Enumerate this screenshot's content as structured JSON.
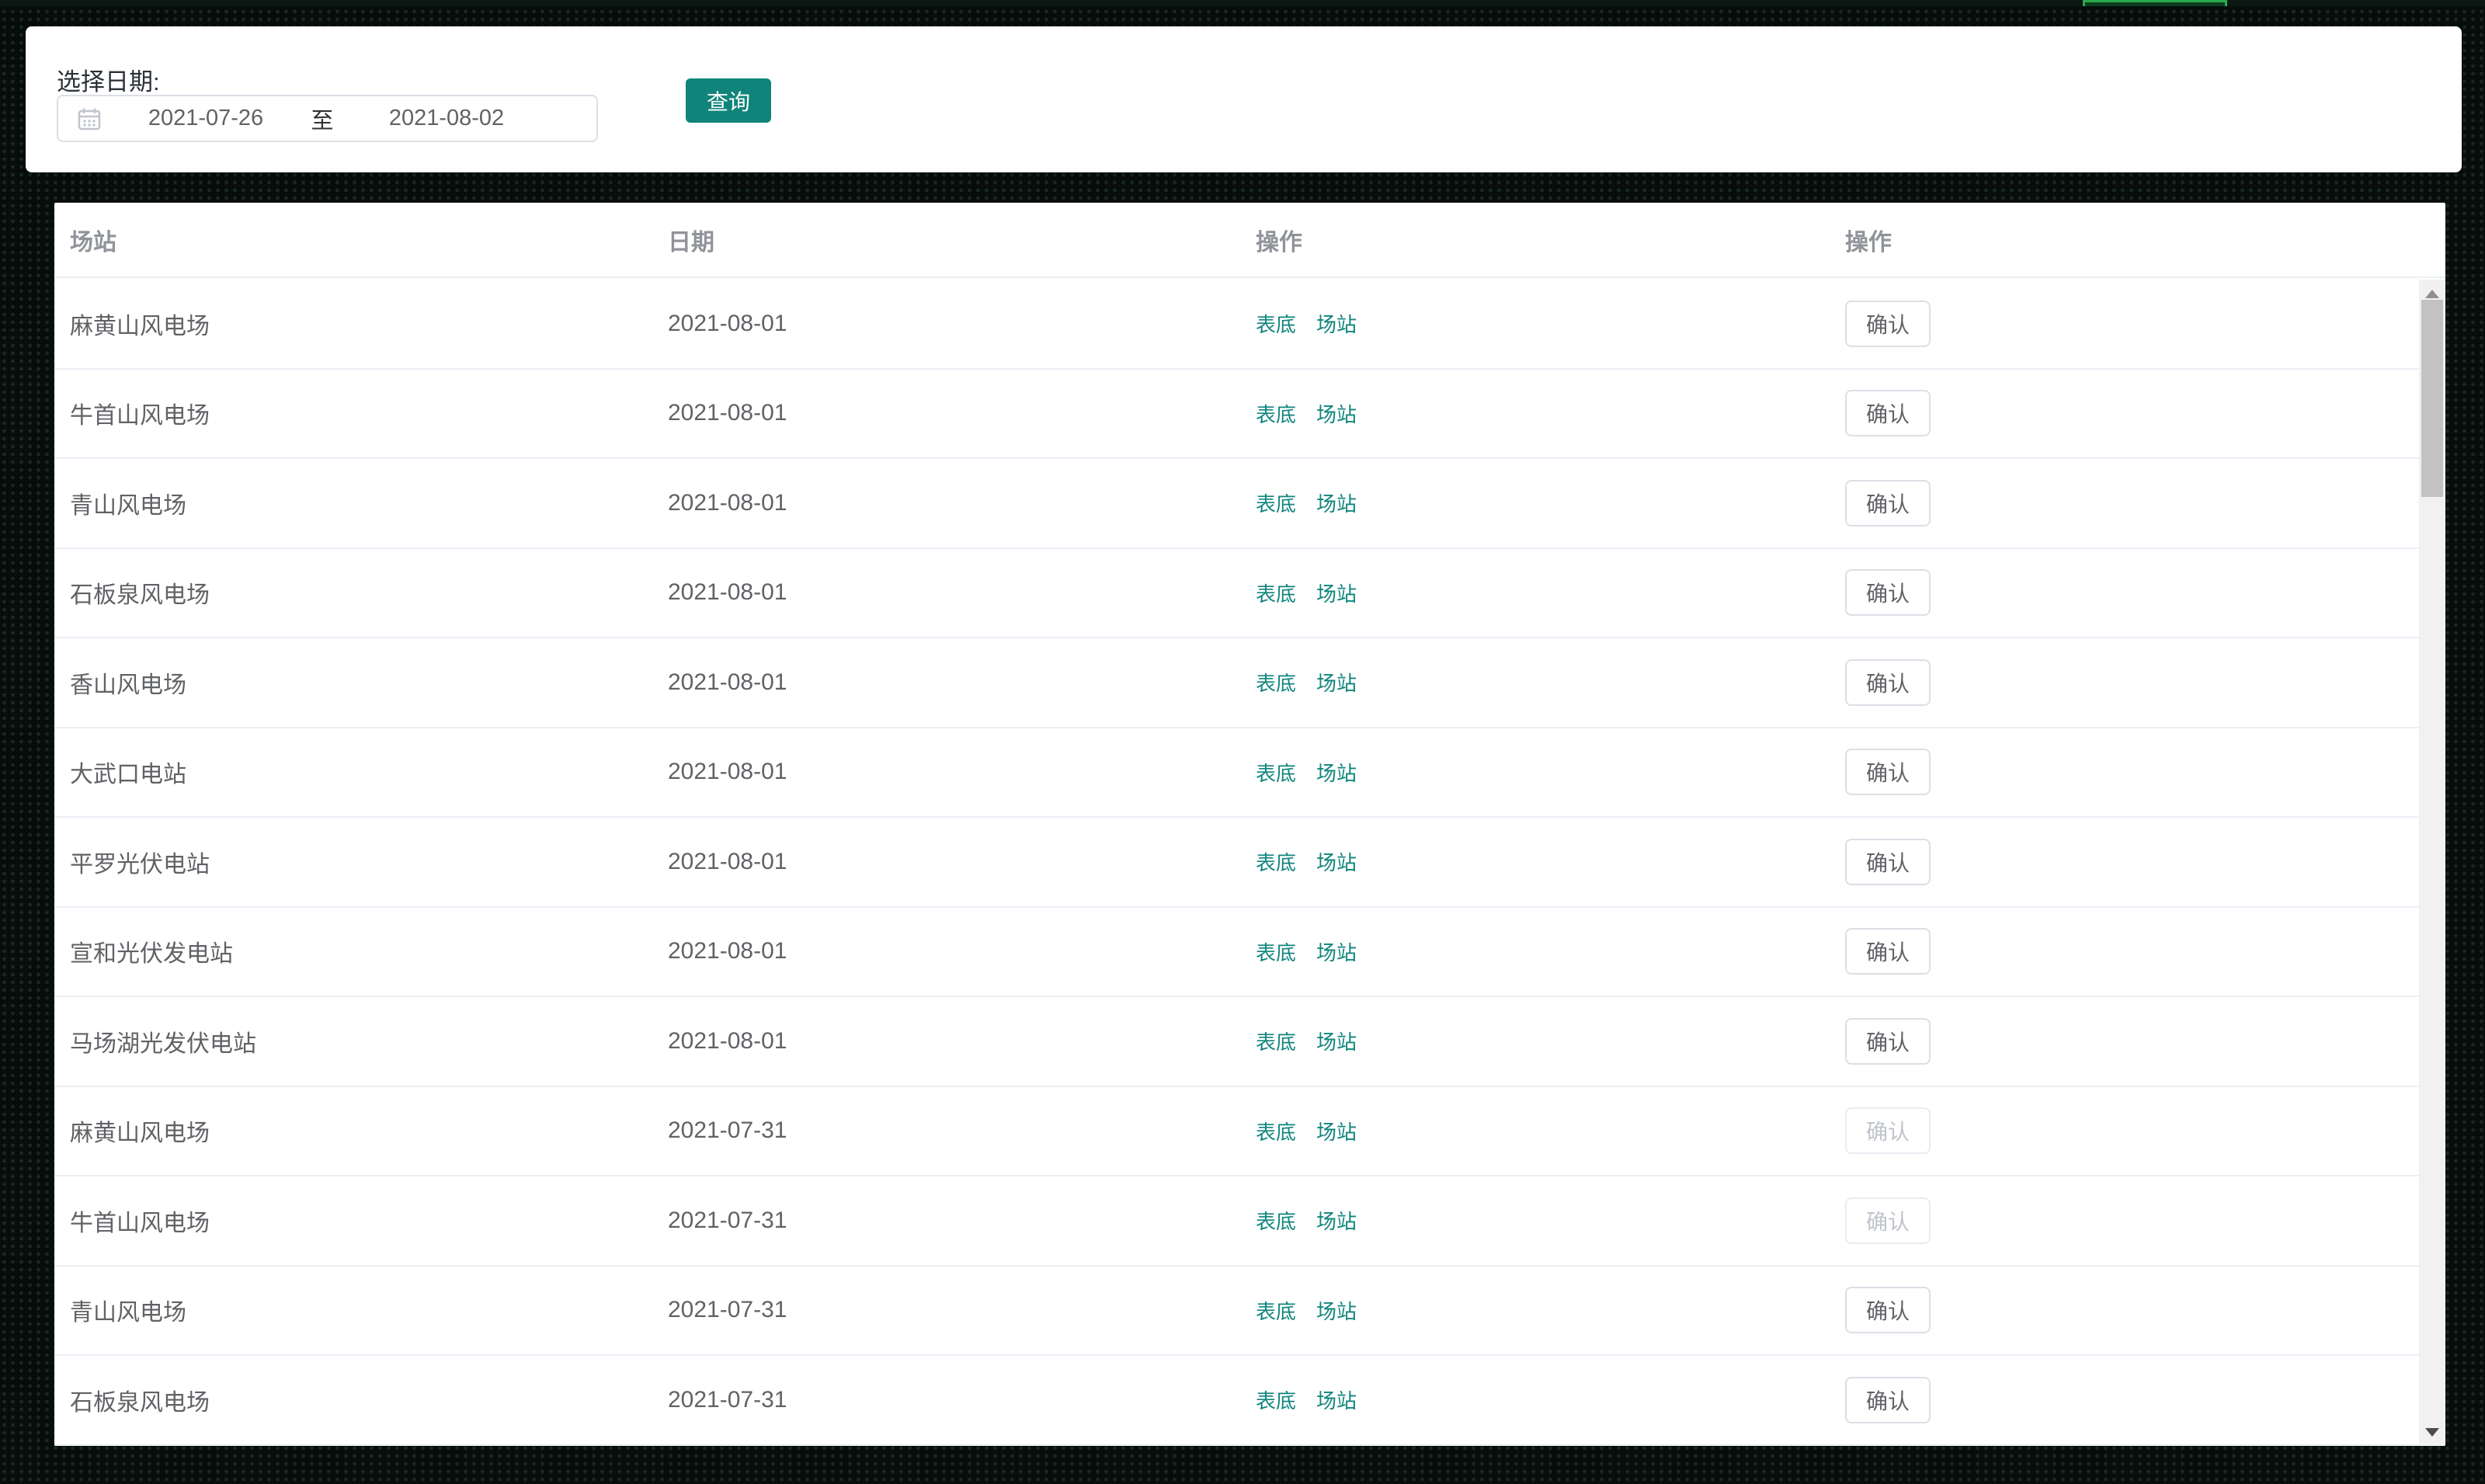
{
  "window": {
    "green_bar_color": "#2aaa4f"
  },
  "filter": {
    "label": "选择日期:",
    "start_date": "2021-07-26",
    "range_separator": "至",
    "end_date": "2021-08-02",
    "query_button_label": "查询"
  },
  "table": {
    "columns": {
      "station": "场站",
      "date": "日期",
      "ops": "操作",
      "confirm": "操作"
    },
    "links": {
      "biaodi": "表底",
      "changzhan": "场站"
    },
    "confirm_button_label": "确认",
    "rows": [
      {
        "station": "麻黄山风电场",
        "date": "2021-08-01",
        "confirm_enabled": true
      },
      {
        "station": "牛首山风电场",
        "date": "2021-08-01",
        "confirm_enabled": true
      },
      {
        "station": "青山风电场",
        "date": "2021-08-01",
        "confirm_enabled": true
      },
      {
        "station": "石板泉风电场",
        "date": "2021-08-01",
        "confirm_enabled": true
      },
      {
        "station": "香山风电场",
        "date": "2021-08-01",
        "confirm_enabled": true
      },
      {
        "station": "大武口电站",
        "date": "2021-08-01",
        "confirm_enabled": true
      },
      {
        "station": "平罗光伏电站",
        "date": "2021-08-01",
        "confirm_enabled": true
      },
      {
        "station": "宣和光伏发电站",
        "date": "2021-08-01",
        "confirm_enabled": true
      },
      {
        "station": "马场湖光发伏电站",
        "date": "2021-08-01",
        "confirm_enabled": true
      },
      {
        "station": "麻黄山风电场",
        "date": "2021-07-31",
        "confirm_enabled": false
      },
      {
        "station": "牛首山风电场",
        "date": "2021-07-31",
        "confirm_enabled": false
      },
      {
        "station": "青山风电场",
        "date": "2021-07-31",
        "confirm_enabled": true
      },
      {
        "station": "石板泉风电场",
        "date": "2021-07-31",
        "confirm_enabled": true
      }
    ]
  },
  "colors": {
    "accent_teal": "#10847b",
    "link_teal": "#11867e",
    "header_text": "#909399",
    "body_text": "#606266",
    "disabled_text": "#c0c4cc"
  }
}
